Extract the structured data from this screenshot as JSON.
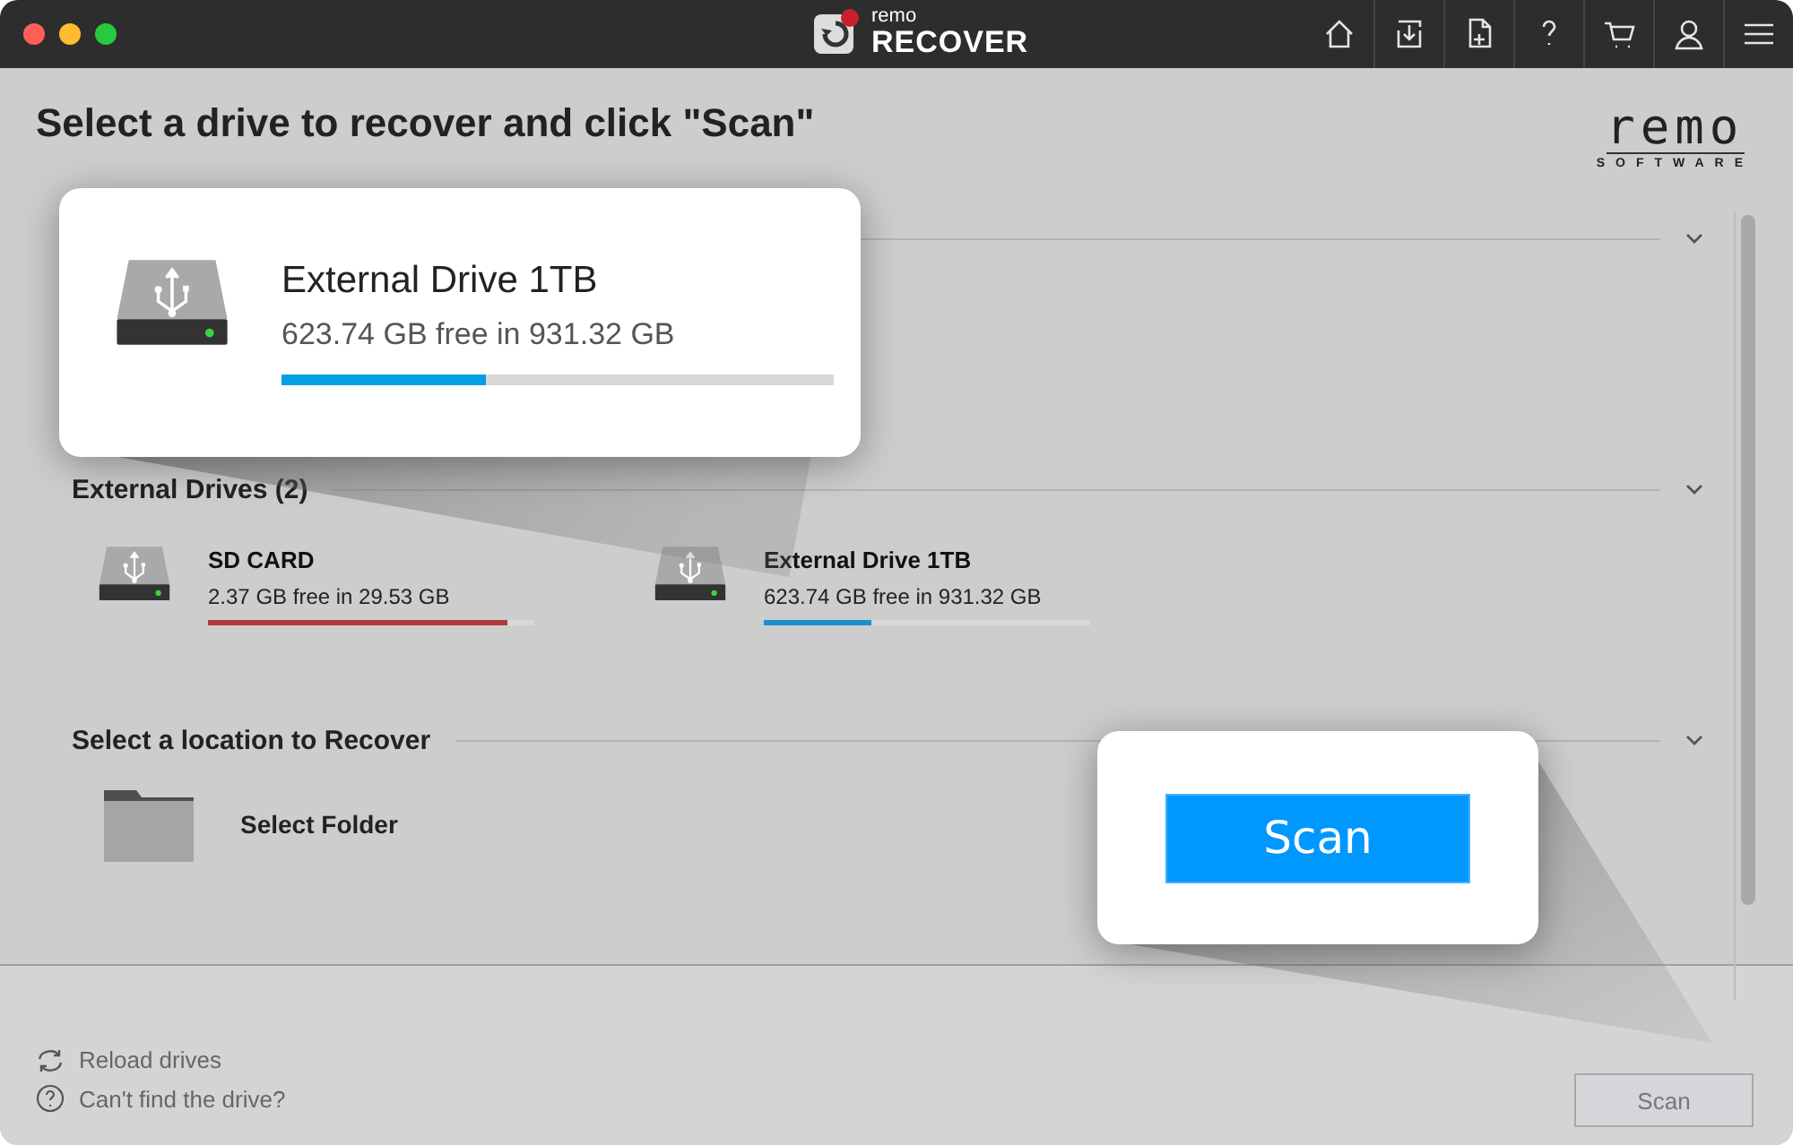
{
  "titlebar": {
    "logo_top": "remo",
    "logo_bottom": "RECOVER"
  },
  "heading": "Select a drive to recover and click \"Scan\"",
  "brand": {
    "name": "remo",
    "tagline": "SOFTWARE"
  },
  "sections": [
    {
      "title": "External Drives (2)",
      "kind": "drives",
      "items": [
        {
          "name": "SD CARD",
          "info": "2.37 GB free in 29.53 GB",
          "level": 0.92,
          "color": "#b23a3a"
        },
        {
          "name": "External Drive 1TB",
          "info": "623.74 GB free in 931.32 GB",
          "level": 0.33,
          "color": "#1a8fd0"
        }
      ]
    },
    {
      "title": "Select a location to Recover",
      "kind": "folder",
      "items": [
        {
          "name": "Select Folder"
        }
      ]
    }
  ],
  "footer": {
    "links": [
      {
        "kind": "reload",
        "label": "Reload drives"
      },
      {
        "kind": "help",
        "label": "Can't find the drive?"
      }
    ],
    "scan_button": {
      "label": "Scan",
      "disabled": true
    }
  },
  "callouts": [
    {
      "kind": "drive",
      "name": "External Drive 1TB",
      "info": "623.74 GB free in 931.32 GB",
      "level": 0.37
    },
    {
      "kind": "button",
      "label": "Scan"
    }
  ]
}
